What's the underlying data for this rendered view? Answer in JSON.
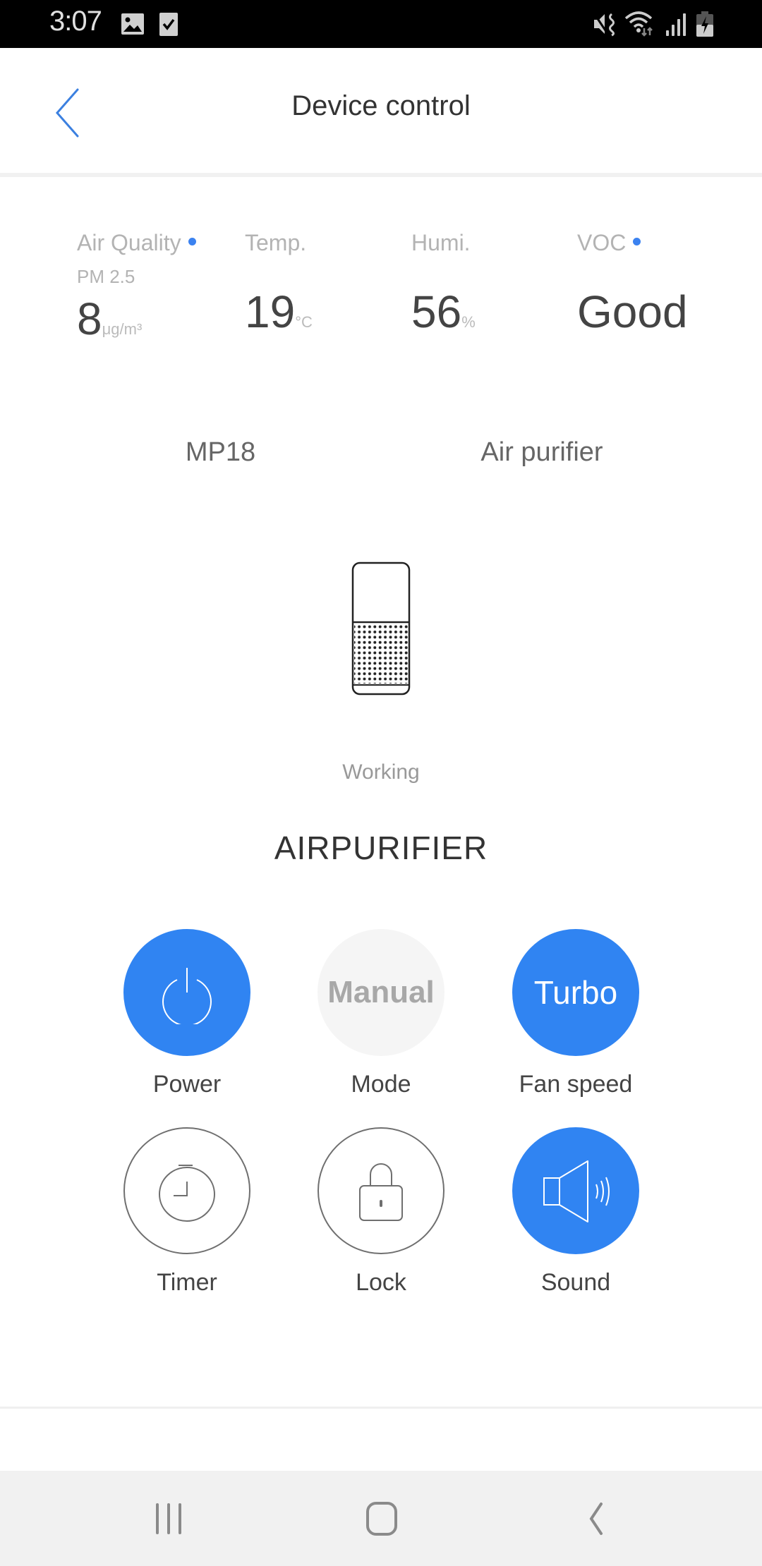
{
  "status_bar": {
    "time": "3:07",
    "left_icons": [
      "gallery-icon",
      "checkbox-icon"
    ],
    "right_icons": [
      "vibrate-mute-icon",
      "wifi-icon",
      "signal-icon",
      "battery-charging-icon"
    ]
  },
  "header": {
    "title": "Device control",
    "back_icon": "chevron-left-icon"
  },
  "sensors": [
    {
      "label": "Air Quality",
      "sub_label": "PM 2.5",
      "value": "8",
      "unit": "μg/m³",
      "indicator": true
    },
    {
      "label": "Temp.",
      "value": "19",
      "unit": "°C",
      "indicator": false
    },
    {
      "label": "Humi.",
      "value": "56",
      "unit": "%",
      "indicator": false
    },
    {
      "label": "VOC",
      "value": "Good",
      "unit": "",
      "indicator": true
    }
  ],
  "device_info": {
    "model": "MP18",
    "type": "Air purifier"
  },
  "device_status": "Working",
  "device_name": "AIRPURIFIER",
  "controls": [
    {
      "label": "Power",
      "icon": "power-icon",
      "state": "active"
    },
    {
      "label": "Mode",
      "value": "Manual",
      "state": "inactive"
    },
    {
      "label": "Fan speed",
      "value": "Turbo",
      "state": "active"
    },
    {
      "label": "Timer",
      "icon": "timer-icon",
      "state": "outline"
    },
    {
      "label": "Lock",
      "icon": "lock-icon",
      "state": "outline"
    },
    {
      "label": "Sound",
      "icon": "speaker-icon",
      "state": "active"
    }
  ],
  "colors": {
    "accent": "#3084f2",
    "indicator": "#3b82f0",
    "inactive_bg": "#f5f5f5"
  },
  "nav_bar": {
    "buttons": [
      "recent-apps",
      "home",
      "back"
    ]
  }
}
